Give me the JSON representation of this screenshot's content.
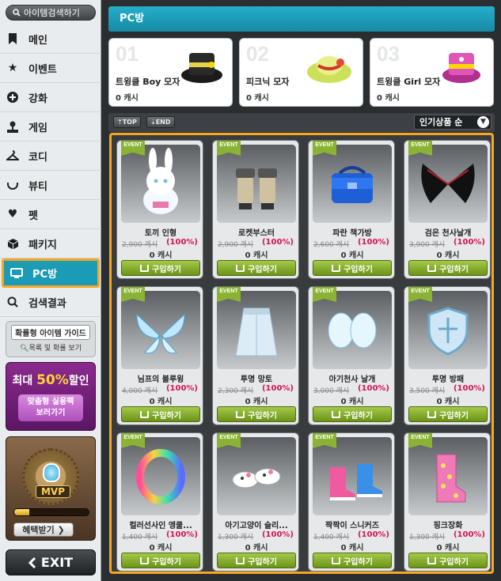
{
  "sidebar": {
    "search_label": "아이템검색하기",
    "items": [
      {
        "label": "메인",
        "icon": "bookmark-icon"
      },
      {
        "label": "이벤트",
        "icon": "star-icon"
      },
      {
        "label": "강화",
        "icon": "plus-circle-icon"
      },
      {
        "label": "게임",
        "icon": "joystick-icon"
      },
      {
        "label": "코디",
        "icon": "hanger-icon"
      },
      {
        "label": "뷰티",
        "icon": "smile-icon"
      },
      {
        "label": "펫",
        "icon": "heart-icon"
      },
      {
        "label": "패키지",
        "icon": "box-icon"
      },
      {
        "label": "PC방",
        "icon": "monitor-icon"
      },
      {
        "label": "검색결과",
        "icon": "search-icon"
      }
    ],
    "active_index": 8,
    "guide": {
      "title": "확률형 아이템 가이드",
      "subtitle": "목록 및 확률 보기"
    },
    "promo": {
      "prefix": "최대",
      "percent": "50%",
      "suffix": "할인",
      "button_line1": "맞춤형 실용팩",
      "button_line2": "보러가기"
    },
    "mvp": {
      "badge_text": "MVP",
      "button_label": "혜택받기 ❯",
      "progress": 0.2
    },
    "exit_label": "EXIT"
  },
  "header": {
    "title": "PC방"
  },
  "top_items": [
    {
      "rank": "01",
      "name": "트윙클 Boy 모자",
      "price": "0 캐시"
    },
    {
      "rank": "02",
      "name": "피크닉 모자",
      "price": "0 캐시"
    },
    {
      "rank": "03",
      "name": "트윙클 Girl 모자",
      "price": "0 캐시"
    }
  ],
  "toolbar": {
    "top_label": "⇡TOP",
    "end_label": "⇣END",
    "sort_label": "인기상품 순"
  },
  "products": [
    {
      "badge": "EVENT",
      "name": "토끼 인형",
      "orig": "2,900 캐시",
      "disc": "(100%)",
      "sale": "0 캐시",
      "buy": "구입하기"
    },
    {
      "badge": "EVENT",
      "name": "로켓부스터",
      "orig": "2,900 캐시",
      "disc": "(100%)",
      "sale": "0 캐시",
      "buy": "구입하기"
    },
    {
      "badge": "EVENT",
      "name": "파란 책가방",
      "orig": "2,600 캐시",
      "disc": "(100%)",
      "sale": "0 캐시",
      "buy": "구입하기"
    },
    {
      "badge": "EVENT",
      "name": "검은 천사날개",
      "orig": "3,900 캐시",
      "disc": "(100%)",
      "sale": "0 캐시",
      "buy": "구입하기"
    },
    {
      "badge": "EVENT",
      "name": "님프의 블루윙",
      "orig": "4,000 캐시",
      "disc": "(100%)",
      "sale": "0 캐시",
      "buy": "구입하기"
    },
    {
      "badge": "EVENT",
      "name": "투명 망토",
      "orig": "2,300 캐시",
      "disc": "(100%)",
      "sale": "0 캐시",
      "buy": "구입하기"
    },
    {
      "badge": "EVENT",
      "name": "아기천사 날개",
      "orig": "3,000 캐시",
      "disc": "(100%)",
      "sale": "0 캐시",
      "buy": "구입하기"
    },
    {
      "badge": "EVENT",
      "name": "투명 방패",
      "orig": "3,500 캐시",
      "disc": "(100%)",
      "sale": "0 캐시",
      "buy": "구입하기"
    },
    {
      "badge": "EVENT",
      "name": "컬러선사인 엥쿨...",
      "orig": "1,400 캐시",
      "disc": "(100%)",
      "sale": "0 캐시",
      "buy": "구입하기"
    },
    {
      "badge": "EVENT",
      "name": "아기고양이 슬리...",
      "orig": "1,300 캐시",
      "disc": "(100%)",
      "sale": "0 캐시",
      "buy": "구입하기"
    },
    {
      "badge": "EVENT",
      "name": "짝짝이 스니커즈",
      "orig": "1,400 캐시",
      "disc": "(100%)",
      "sale": "0 캐시",
      "buy": "구입하기"
    },
    {
      "badge": "EVENT",
      "name": "핑크장화",
      "orig": "1,300 캐시",
      "disc": "(100%)",
      "sale": "0 캐시",
      "buy": "구입하기"
    }
  ]
}
